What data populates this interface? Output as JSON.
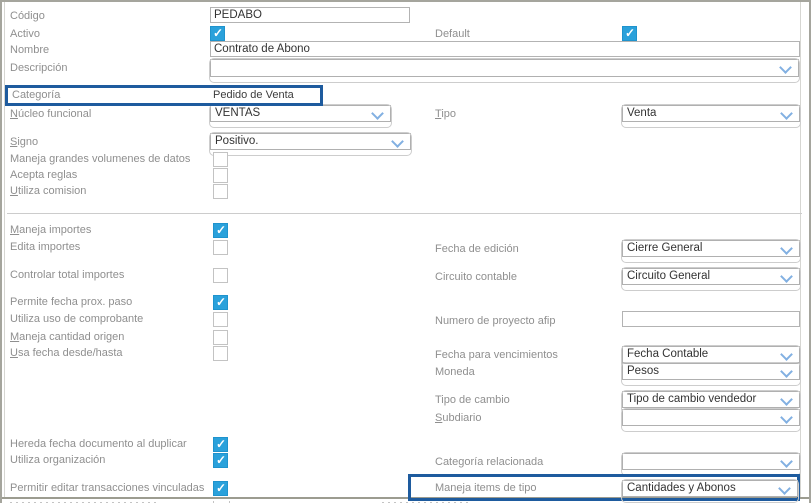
{
  "colors": {
    "checkbox_checked": "#2aa1db",
    "highlight_border": "#1e5b9e",
    "chevron": "#82b0e2",
    "label_gray": "#8f8f8f",
    "frame_border": "#a5a59d"
  },
  "fields": {
    "codigo": {
      "label": "Código",
      "value": "PEDABO"
    },
    "activo": {
      "label": "Activo",
      "checked": true
    },
    "default": {
      "label": "Default",
      "checked": true
    },
    "nombre": {
      "label": "Nombre",
      "value": "Contrato de Abono"
    },
    "descripcion": {
      "label": "Descripción",
      "value": ""
    },
    "categoria": {
      "label": "Categoría",
      "value": "Pedido de Venta"
    },
    "nucleo_funcional": {
      "label": "Núcleo funcional",
      "value": "VENTAS"
    },
    "tipo": {
      "label": "Tipo",
      "value": "Venta"
    },
    "signo": {
      "label": "Signo",
      "value": "Positivo."
    },
    "maneja_grandes_volumenes": {
      "label": "Maneja grandes volumenes de datos",
      "checked": false
    },
    "acepta_reglas": {
      "label": "Acepta reglas",
      "checked": false
    },
    "utiliza_comision": {
      "label": "Utiliza comision",
      "checked": false
    },
    "maneja_importes": {
      "label": "Maneja importes",
      "checked": true
    },
    "edita_importes": {
      "label": "Edita importes",
      "checked": false
    },
    "fecha_de_edicion": {
      "label": "Fecha de edición",
      "value": "Cierre General"
    },
    "controlar_total_importes": {
      "label": "Controlar total importes",
      "checked": false
    },
    "circuito_contable": {
      "label": "Circuito contable",
      "value": "Circuito General"
    },
    "permite_fecha_prox_paso": {
      "label": "Permite fecha prox. paso",
      "checked": true
    },
    "utiliza_uso_comprobante": {
      "label": "Utiliza uso de comprobante",
      "checked": false
    },
    "numero_proyecto_afip": {
      "label": "Numero de proyecto afip",
      "value": ""
    },
    "maneja_cantidad_origen": {
      "label": "Maneja cantidad origen",
      "checked": false
    },
    "usa_fecha_desde_hasta": {
      "label": "Usa fecha desde/hasta",
      "checked": false
    },
    "fecha_para_vencimientos": {
      "label": "Fecha para vencimientos",
      "value": "Fecha Contable"
    },
    "moneda": {
      "label": "Moneda",
      "value": "Pesos"
    },
    "tipo_de_cambio": {
      "label": "Tipo de cambio",
      "value": "Tipo de cambio vendedor"
    },
    "subdiario": {
      "label": "Subdiario",
      "value": ""
    },
    "hereda_fecha_documento": {
      "label": "Hereda fecha documento al duplicar",
      "checked": true
    },
    "utiliza_organizacion": {
      "label": "Utiliza organización",
      "checked": true
    },
    "categoria_relacionada": {
      "label": "Categoría relacionada",
      "value": ""
    },
    "permitir_editar_transacciones": {
      "label": "Permitir editar transacciones vinculadas",
      "checked": true
    },
    "maneja_items_de_tipo": {
      "label": "Maneja items de tipo",
      "value": "Cantidades y Abonos"
    }
  }
}
